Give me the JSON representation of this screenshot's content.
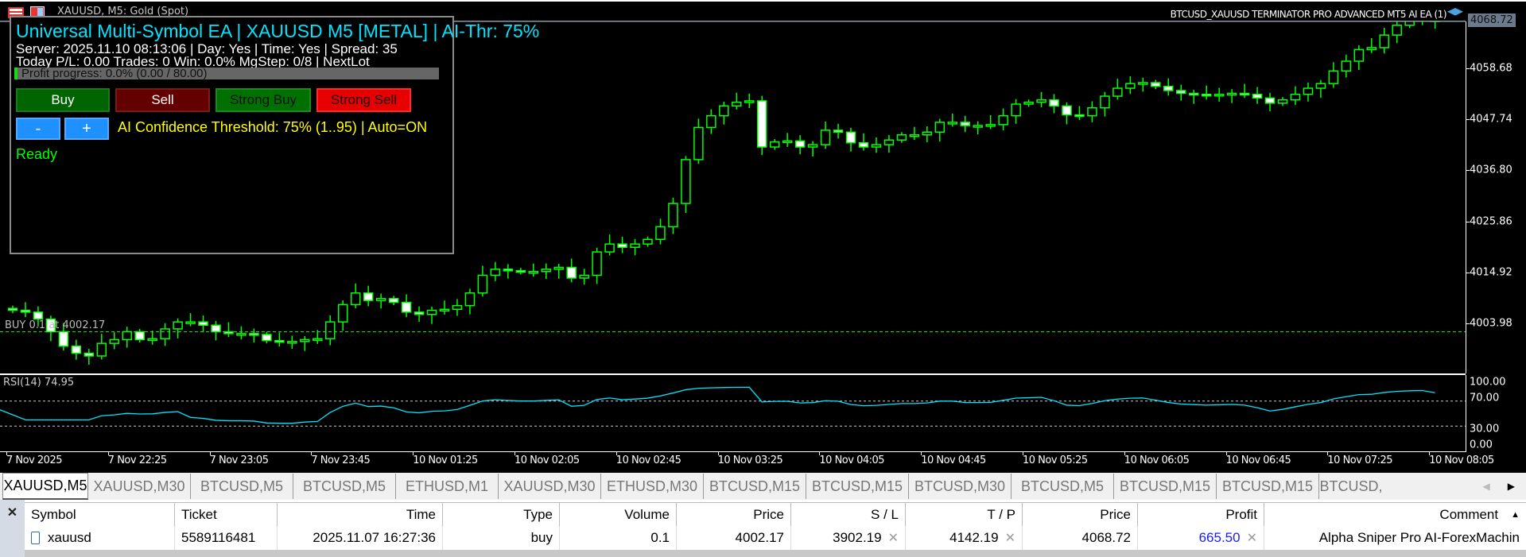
{
  "window": {
    "symbol_title": "XAUUSD, M5:  Gold (Spot)",
    "ea_name": "BTCUSD_XAUUSD TERMINATOR PRO ADVANCED MT5 AI EA (1)"
  },
  "panel": {
    "title": "Universal Multi-Symbol EA | XAUUSD M5 [METAL] | AI-Thr: 75%",
    "line1": "Server: 2025.11.10 08:13:06 | Day: Yes | Time: Yes | Spread: 35",
    "line2": "Today P/L: 0.00   Trades: 0   Win: 0.0%   MgStep: 0/8 | NextLot",
    "progress_text": "Profit progress: 0.0% (0.00 / 80.00)",
    "progress_percent": 0.0,
    "buttons": {
      "buy": "Buy",
      "sell": "Sell",
      "strong_buy": "Strong Buy",
      "strong_sell": "Strong Sell",
      "minus": "-",
      "plus": "+"
    },
    "ai_threshold": "AI Confidence Threshold: 75% (1..95) | Auto=ON",
    "status": "Ready"
  },
  "chart": {
    "current_price": "4068.72",
    "price_labels": [
      "4068.72",
      "4058.68",
      "4047.74",
      "4036.80",
      "4025.86",
      "4014.92",
      "4003.98"
    ],
    "price_values": [
      4068.72,
      4058.68,
      4047.74,
      4036.8,
      4025.86,
      4014.92,
      4003.98
    ],
    "order_line_label": "BUY 0.1 at 4002.17",
    "order_price": 4002.17,
    "rsi_label": "RSI(14) 74.95",
    "rsi_levels": [
      "100.00",
      "70.00",
      "30.00",
      "0.00"
    ],
    "time_labels": [
      "7 Nov 2025",
      "7 Nov 22:25",
      "7 Nov 23:05",
      "7 Nov 23:45",
      "10 Nov 01:25",
      "10 Nov 02:05",
      "10 Nov 02:45",
      "10 Nov 03:25",
      "10 Nov 04:05",
      "10 Nov 04:45",
      "10 Nov 05:25",
      "10 Nov 06:05",
      "10 Nov 06:45",
      "10 Nov 07:25",
      "10 Nov 08:05"
    ],
    "colors": {
      "candle": "#00ff00",
      "rsi": "#00e5ff",
      "order_line": "#00ff00"
    },
    "closes": [
      4006.8,
      4006.4,
      4004.9,
      4002.2,
      3999.1,
      3997.6,
      3997.0,
      3999.7,
      4000.5,
      4002.2,
      4000.5,
      4000.7,
      4002.8,
      4004.3,
      4004.3,
      4003.6,
      4002.2,
      4001.8,
      4001.8,
      4001.6,
      4000.3,
      4000.1,
      4000.1,
      4000.5,
      4000.7,
      4004.3,
      4008.0,
      4010.5,
      4008.9,
      4009.3,
      4008.5,
      4006.4,
      4005.9,
      4006.8,
      4007.0,
      4007.8,
      4010.5,
      4014.3,
      4015.6,
      4015.3,
      4015.1,
      4015.1,
      4015.6,
      4016.0,
      4013.7,
      4014.3,
      4019.3,
      4021.0,
      4020.3,
      4021.0,
      4022.0,
      4024.7,
      4029.7,
      4039.1,
      4046.0,
      4048.5,
      4050.6,
      4051.4,
      4051.7,
      4041.8,
      4042.9,
      4043.1,
      4041.8,
      4042.3,
      4045.4,
      4045.0,
      4042.7,
      4041.8,
      4042.3,
      4043.3,
      4044.4,
      4044.4,
      4045.0,
      4047.1,
      4047.1,
      4046.4,
      4046.4,
      4046.6,
      4048.5,
      4051.0,
      4051.4,
      4051.9,
      4050.6,
      4048.7,
      4048.5,
      4050.2,
      4052.7,
      4054.4,
      4055.4,
      4055.6,
      4054.8,
      4053.9,
      4053.3,
      4053.1,
      4052.9,
      4053.1,
      4053.3,
      4053.1,
      4052.3,
      4051.2,
      4051.9,
      4053.1,
      4054.4,
      4055.4,
      4058.1,
      4060.2,
      4062.7,
      4063.1,
      4065.8,
      4067.9,
      4069.0,
      4069.4,
      4068.72
    ]
  },
  "tabs": [
    "XAUUSD,M5",
    "XAUUSD,M30",
    "BTCUSD,M5",
    "BTCUSD,M5",
    "ETHUSD,M1",
    "XAUUSD,M30",
    "ETHUSD,M30",
    "BTCUSD,M15",
    "BTCUSD,M15",
    "BTCUSD,M30",
    "BTCUSD,M5",
    "BTCUSD,M15",
    "BTCUSD,M15",
    "BTCUSD,"
  ],
  "table": {
    "close_label": "✕",
    "headers": [
      "Symbol",
      "Ticket",
      "Time",
      "Type",
      "Volume",
      "Price",
      "S / L",
      "T / P",
      "Price",
      "Profit",
      "Comment"
    ],
    "rows": [
      {
        "symbol": "xauusd",
        "ticket": "5589116481",
        "time": "2025.11.07 16:27:36",
        "type": "buy",
        "volume": "0.1",
        "price": "4002.17",
        "sl": "3902.19",
        "tp": "4142.19",
        "cur_price": "4068.72",
        "profit": "665.50",
        "comment": "Alpha Sniper Pro AI-ForexMachin"
      }
    ],
    "profit_color": "#1a1aff"
  }
}
